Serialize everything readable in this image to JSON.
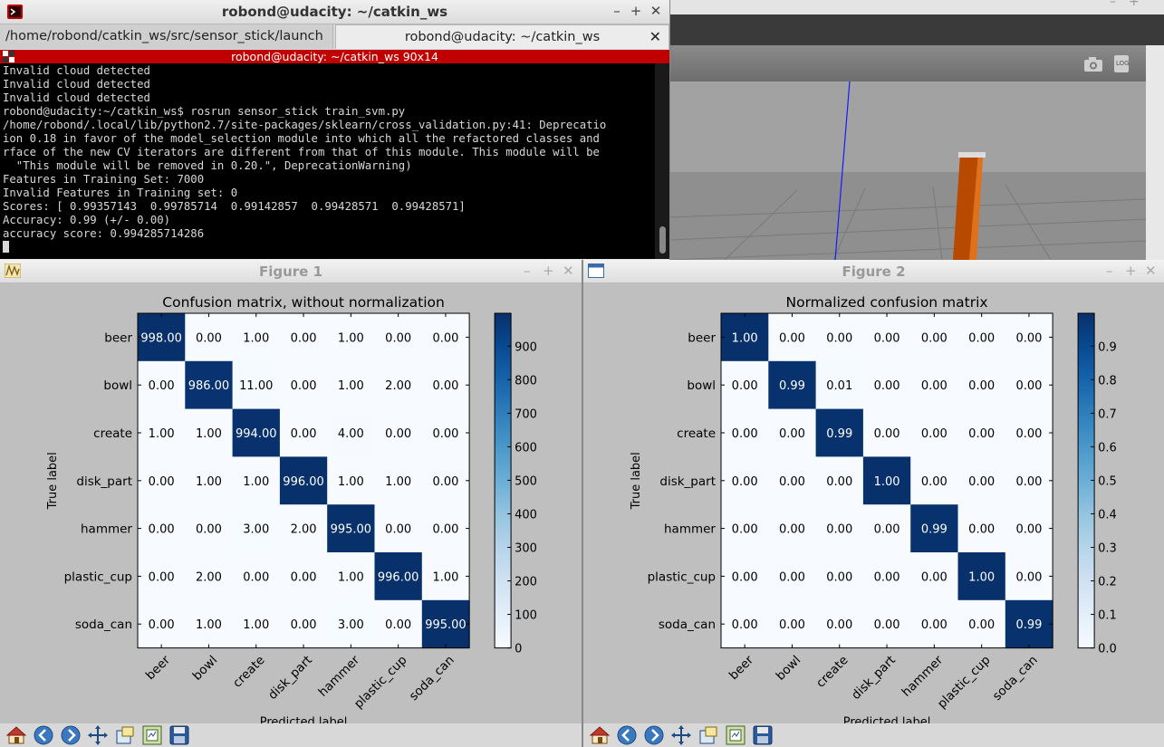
{
  "terminal": {
    "title": "robond@udacity: ~/catkin_ws",
    "tabs": [
      "/home/robond/catkin_ws/src/sensor_stick/launch",
      "robond@udacity: ~/catkin_ws"
    ],
    "subtitle": "robond@udacity: ~/catkin_ws 90x14",
    "lines": [
      "Invalid cloud detected",
      "Invalid cloud detected",
      "Invalid cloud detected",
      "robond@udacity:~/catkin_ws$ rosrun sensor_stick train_svm.py",
      "/home/robond/.local/lib/python2.7/site-packages/sklearn/cross_validation.py:41: Deprecatio",
      "ion 0.18 in favor of the model_selection module into which all the refactored classes and",
      "rface of the new CV iterators are different from that of this module. This module will be",
      "  \"This module will be removed in 0.20.\", DeprecationWarning)",
      "Features in Training Set: 7000",
      "Invalid Features in Training set: 0",
      "Scores: [ 0.99357143  0.99785714  0.99142857  0.99428571  0.99428571]",
      "Accuracy: 0.99 (+/- 0.00)",
      "accuracy score: 0.994285714286"
    ]
  },
  "gazebo": {
    "bar_buttons": [
      "camera-icon",
      "log-icon"
    ]
  },
  "figure1": {
    "window_title": "Figure 1"
  },
  "figure2": {
    "window_title": "Figure 2"
  },
  "toolbar_icons": [
    "home-icon",
    "back-icon",
    "forward-icon",
    "pan-icon",
    "zoom-icon",
    "subplots-icon",
    "save-icon"
  ],
  "chart_data": [
    {
      "type": "heatmap",
      "title": "Confusion matrix, without normalization",
      "xlabel": "Predicted label",
      "ylabel": "True label",
      "categories": [
        "beer",
        "bowl",
        "create",
        "disk_part",
        "hammer",
        "plastic_cup",
        "soda_can"
      ],
      "values": [
        [
          998,
          0,
          1,
          0,
          1,
          0,
          0
        ],
        [
          0,
          986,
          11,
          0,
          1,
          2,
          0
        ],
        [
          1,
          1,
          994,
          0,
          4,
          0,
          0
        ],
        [
          0,
          1,
          1,
          996,
          1,
          1,
          0
        ],
        [
          0,
          0,
          3,
          2,
          995,
          0,
          0
        ],
        [
          0,
          2,
          0,
          0,
          1,
          996,
          1
        ],
        [
          0,
          1,
          1,
          0,
          3,
          0,
          995
        ]
      ],
      "decimals": 2,
      "vmax": 998,
      "colorbar_ticks": [
        0,
        100,
        200,
        300,
        400,
        500,
        600,
        700,
        800,
        900
      ],
      "colorbar_labels": [
        "0",
        "100",
        "200",
        "300",
        "400",
        "500",
        "600",
        "700",
        "800",
        "900"
      ],
      "colormap": "Blues"
    },
    {
      "type": "heatmap",
      "title": "Normalized confusion matrix",
      "xlabel": "Predicted label",
      "ylabel": "True label",
      "categories": [
        "beer",
        "bowl",
        "create",
        "disk_part",
        "hammer",
        "plastic_cup",
        "soda_can"
      ],
      "values": [
        [
          1.0,
          0.0,
          0.0,
          0.0,
          0.0,
          0.0,
          0.0
        ],
        [
          0.0,
          0.99,
          0.01,
          0.0,
          0.0,
          0.0,
          0.0
        ],
        [
          0.0,
          0.0,
          0.99,
          0.0,
          0.0,
          0.0,
          0.0
        ],
        [
          0.0,
          0.0,
          0.0,
          1.0,
          0.0,
          0.0,
          0.0
        ],
        [
          0.0,
          0.0,
          0.0,
          0.0,
          0.99,
          0.0,
          0.0
        ],
        [
          0.0,
          0.0,
          0.0,
          0.0,
          0.0,
          1.0,
          0.0
        ],
        [
          0.0,
          0.0,
          0.0,
          0.0,
          0.0,
          0.0,
          0.99
        ]
      ],
      "decimals": 2,
      "vmax": 0.998,
      "colorbar_ticks": [
        0.0,
        0.1,
        0.2,
        0.3,
        0.4,
        0.5,
        0.6,
        0.7,
        0.8,
        0.9
      ],
      "colorbar_labels": [
        "0.0",
        "0.1",
        "0.2",
        "0.3",
        "0.4",
        "0.5",
        "0.6",
        "0.7",
        "0.8",
        "0.9"
      ],
      "colormap": "Blues"
    }
  ]
}
